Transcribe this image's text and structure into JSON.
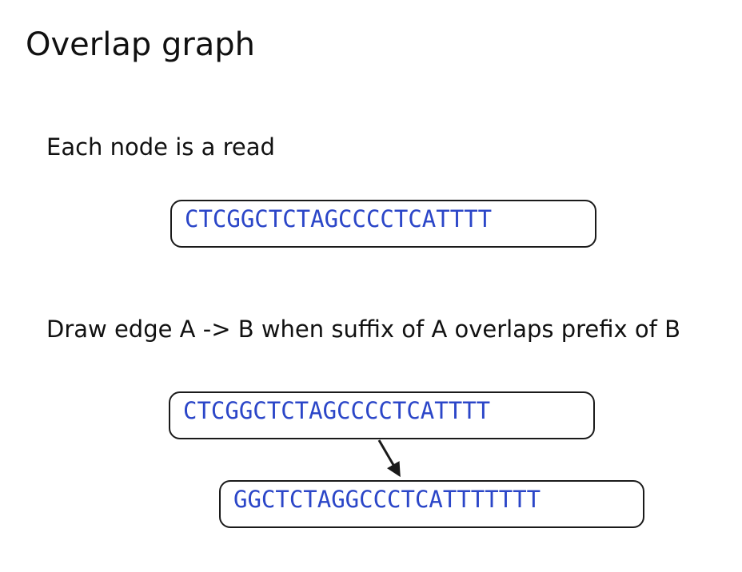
{
  "slide": {
    "title": "Overlap graph",
    "bullets": [
      "Each node is a read",
      "Draw edge A -> B when suffix of A overlaps prefix of B"
    ]
  },
  "diagram": {
    "node_example": "CTCGGCTCTAGCCCCTCATTTT",
    "edge_source": "CTCGGCTCTAGCCCCTCATTTT",
    "edge_target": "GGCTCTAGGCCCTCATTTTTTT"
  },
  "colors": {
    "sequence_text": "#2b46c8",
    "box_border": "#1a1a1a"
  }
}
